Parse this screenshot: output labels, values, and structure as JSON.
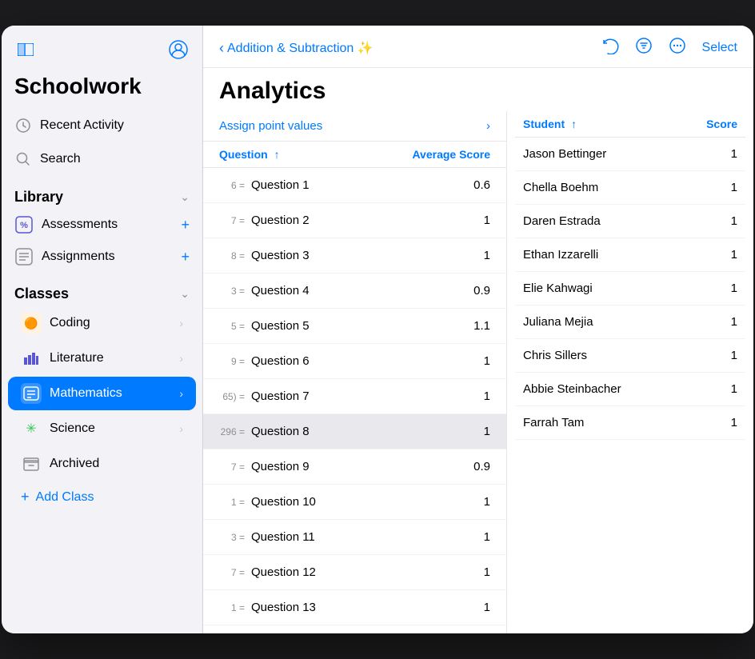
{
  "app": {
    "title": "Schoolwork"
  },
  "sidebar": {
    "nav_items": [
      {
        "id": "recent-activity",
        "label": "Recent Activity",
        "icon": "🕐"
      },
      {
        "id": "search",
        "label": "Search",
        "icon": "🔍"
      }
    ],
    "library": {
      "title": "Library",
      "items": [
        {
          "id": "assessments",
          "label": "Assessments",
          "icon": "%"
        },
        {
          "id": "assignments",
          "label": "Assignments",
          "icon": "📋"
        }
      ]
    },
    "classes": {
      "title": "Classes",
      "items": [
        {
          "id": "coding",
          "label": "Coding",
          "icon": "🟠",
          "active": false
        },
        {
          "id": "literature",
          "label": "Literature",
          "icon": "📊",
          "active": false
        },
        {
          "id": "mathematics",
          "label": "Mathematics",
          "icon": "📘",
          "active": true
        },
        {
          "id": "science",
          "label": "Science",
          "icon": "✳️",
          "active": false
        },
        {
          "id": "archived",
          "label": "Archived",
          "icon": "🗂",
          "active": false
        }
      ],
      "add_label": "Add Class"
    }
  },
  "header": {
    "back_label": "Addition & Subtraction ✨",
    "page_title": "Analytics",
    "select_label": "Select"
  },
  "questions_panel": {
    "assign_point_label": "Assign point values",
    "col_question": "Question",
    "col_avg_score": "Average Score",
    "questions": [
      {
        "id": 1,
        "number": "6 =",
        "label": "Question 1",
        "score": "0.6"
      },
      {
        "id": 2,
        "number": "7 =",
        "label": "Question 2",
        "score": "1"
      },
      {
        "id": 3,
        "number": "8 =",
        "label": "Question 3",
        "score": "1"
      },
      {
        "id": 4,
        "number": "3 =",
        "label": "Question 4",
        "score": "0.9"
      },
      {
        "id": 5,
        "number": "5 =",
        "label": "Question 5",
        "score": "1.1"
      },
      {
        "id": 6,
        "number": "9 =",
        "label": "Question 6",
        "score": "1"
      },
      {
        "id": 7,
        "number": "65) =",
        "label": "Question 7",
        "score": "1"
      },
      {
        "id": 8,
        "number": "296 =",
        "label": "Question 8",
        "score": "1",
        "selected": true
      },
      {
        "id": 9,
        "number": "7 =",
        "label": "Question 9",
        "score": "0.9"
      },
      {
        "id": 10,
        "number": "1 =",
        "label": "Question 10",
        "score": "1"
      },
      {
        "id": 11,
        "number": "3 =",
        "label": "Question 11",
        "score": "1"
      },
      {
        "id": 12,
        "number": "7 =",
        "label": "Question 12",
        "score": "1"
      },
      {
        "id": 13,
        "number": "1 =",
        "label": "Question 13",
        "score": "1"
      }
    ]
  },
  "students_panel": {
    "col_student": "Student",
    "col_score": "Score",
    "students": [
      {
        "name": "Jason Bettinger",
        "score": "1"
      },
      {
        "name": "Chella Boehm",
        "score": "1"
      },
      {
        "name": "Daren Estrada",
        "score": "1"
      },
      {
        "name": "Ethan Izzarelli",
        "score": "1"
      },
      {
        "name": "Elie Kahwagi",
        "score": "1"
      },
      {
        "name": "Juliana Mejia",
        "score": "1"
      },
      {
        "name": "Chris Sillers",
        "score": "1"
      },
      {
        "name": "Abbie Steinbacher",
        "score": "1"
      },
      {
        "name": "Farrah Tam",
        "score": "1"
      }
    ]
  }
}
